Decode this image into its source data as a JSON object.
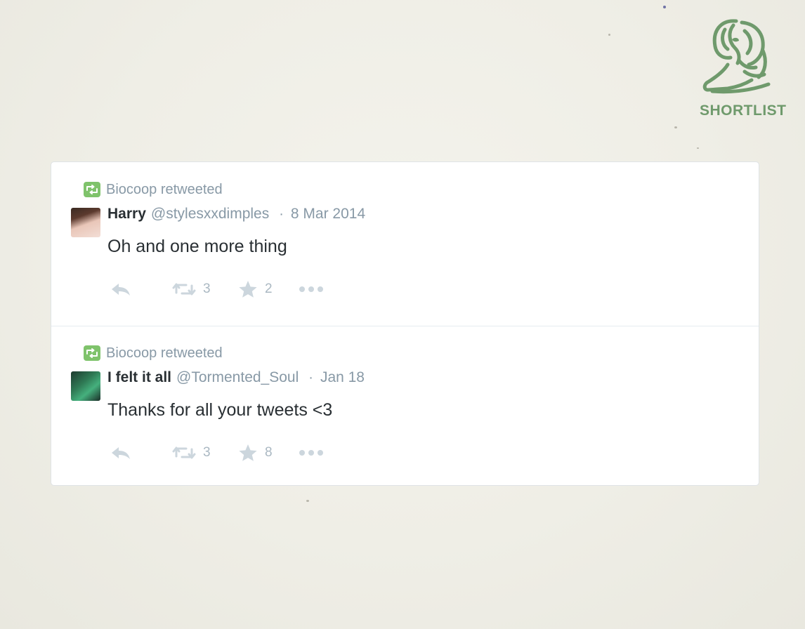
{
  "badge": {
    "label": "SHORTLIST",
    "color": "#6f9a6c",
    "icon": "lion-icon"
  },
  "colors": {
    "name": "#292f33",
    "meta": "#8899a6",
    "action": "#aab8c2",
    "retweet_badge": "#7fc36b"
  },
  "tweets": [
    {
      "retweeted_by": "Biocoop retweeted",
      "name": "Harry",
      "handle": "@stylesxxdimples",
      "dot": "·",
      "date": "8 Mar 2014",
      "text": "Oh and one more thing",
      "retweets": "3",
      "favorites": "2"
    },
    {
      "retweeted_by": "Biocoop retweeted",
      "name": "I felt it all",
      "handle": "@Tormented_Soul",
      "dot": "·",
      "date": "Jan 18",
      "text": "Thanks for all your tweets <3",
      "retweets": "3",
      "favorites": "8"
    }
  ]
}
